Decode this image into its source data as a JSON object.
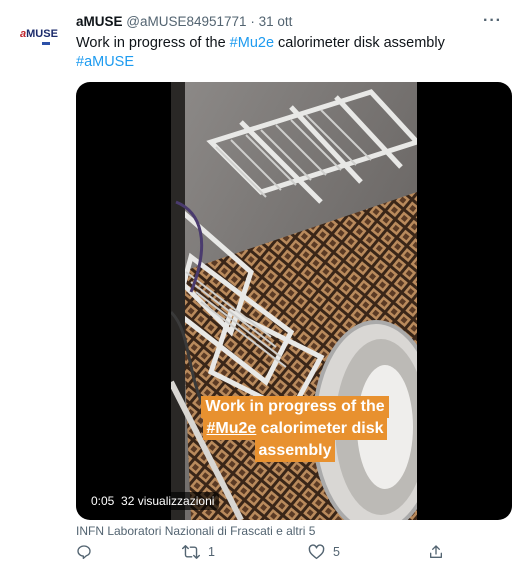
{
  "author": {
    "avatar_text_a": "a",
    "avatar_text_rest": "MUSE",
    "name": "aMUSE",
    "handle": "@aMUSE84951771",
    "separator": "·",
    "date": "31 ott"
  },
  "more_label": "···",
  "tweet": {
    "text_before": "Work in progress of the ",
    "hashtag_1": "#Mu2e",
    "text_after": " calorimeter disk assembly",
    "hashtag_2": "#aMUSE"
  },
  "video": {
    "caption_line1": "Work in progress of the",
    "caption_hash": "#Mu2e",
    "caption_line2_rest": " calorimeter disk",
    "caption_line3": "assembly",
    "caption_color": "#e8912f",
    "time": "0:05",
    "views": "32 visualizzazioni"
  },
  "source": "INFN Laboratori Nazionali di Frascati e altri 5",
  "actions": {
    "reply_count": "",
    "retweet_count": "1",
    "like_count": "5"
  },
  "colors": {
    "link": "#1d9bf0",
    "secondary_text": "#536471",
    "primary_text": "#0f1419"
  },
  "icons": [
    "reply-icon",
    "retweet-icon",
    "like-icon",
    "share-icon",
    "more-icon"
  ]
}
